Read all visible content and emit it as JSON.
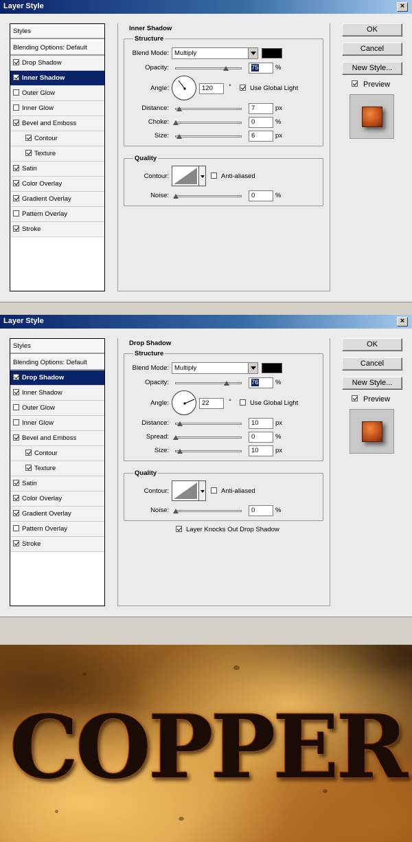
{
  "dialogs": [
    {
      "title": "Layer Style",
      "styles_header": "Styles",
      "blending_options": "Blending Options: Default",
      "items": [
        {
          "label": "Drop Shadow",
          "checked": true
        },
        {
          "label": "Inner Shadow",
          "checked": true,
          "selected": true
        },
        {
          "label": "Outer Glow",
          "checked": false
        },
        {
          "label": "Inner Glow",
          "checked": false
        },
        {
          "label": "Bevel and Emboss",
          "checked": true
        },
        {
          "label": "Contour",
          "checked": true,
          "indent": true
        },
        {
          "label": "Texture",
          "checked": true,
          "indent": true
        },
        {
          "label": "Satin",
          "checked": true
        },
        {
          "label": "Color Overlay",
          "checked": true
        },
        {
          "label": "Gradient Overlay",
          "checked": true
        },
        {
          "label": "Pattern Overlay",
          "checked": false
        },
        {
          "label": "Stroke",
          "checked": true
        }
      ],
      "section_title": "Inner Shadow",
      "structure": {
        "label": "Structure",
        "blend_mode_label": "Blend Mode:",
        "blend_mode": "Multiply",
        "shadow_color": "#000000",
        "opacity_label": "Opacity:",
        "opacity": "75",
        "angle_label": "Angle:",
        "angle": "120",
        "angle_unit": "°",
        "use_global_light": "Use Global Light",
        "use_global_light_checked": true,
        "row3_label": "Distance:",
        "row3": "7",
        "row3_unit": "px",
        "row4_label": "Choke:",
        "row4": "0",
        "row4_unit": "%",
        "row5_label": "Size:",
        "row5": "6",
        "row5_unit": "px",
        "percent": "%"
      },
      "quality": {
        "label": "Quality",
        "contour_label": "Contour:",
        "anti_aliased": "Anti-aliased",
        "anti_aliased_checked": false,
        "noise_label": "Noise:",
        "noise": "0",
        "noise_unit": "%"
      },
      "buttons": {
        "ok": "OK",
        "cancel": "Cancel",
        "new_style": "New Style..."
      },
      "preview": "Preview",
      "preview_checked": true
    },
    {
      "title": "Layer Style",
      "styles_header": "Styles",
      "blending_options": "Blending Options: Default",
      "items": [
        {
          "label": "Drop Shadow",
          "checked": true,
          "selected": true
        },
        {
          "label": "Inner Shadow",
          "checked": true
        },
        {
          "label": "Outer Glow",
          "checked": false
        },
        {
          "label": "Inner Glow",
          "checked": false
        },
        {
          "label": "Bevel and Emboss",
          "checked": true
        },
        {
          "label": "Contour",
          "checked": true,
          "indent": true
        },
        {
          "label": "Texture",
          "checked": true,
          "indent": true
        },
        {
          "label": "Satin",
          "checked": true
        },
        {
          "label": "Color Overlay",
          "checked": true
        },
        {
          "label": "Gradient Overlay",
          "checked": true
        },
        {
          "label": "Pattern Overlay",
          "checked": false
        },
        {
          "label": "Stroke",
          "checked": true
        }
      ],
      "section_title": "Drop Shadow",
      "structure": {
        "label": "Structure",
        "blend_mode_label": "Blend Mode:",
        "blend_mode": "Multiply",
        "shadow_color": "#000000",
        "opacity_label": "Opacity:",
        "opacity": "76",
        "angle_label": "Angle:",
        "angle": "22",
        "angle_unit": "°",
        "use_global_light": "Use Global Light",
        "use_global_light_checked": false,
        "row3_label": "Distance:",
        "row3": "10",
        "row3_unit": "px",
        "row4_label": "Spread:",
        "row4": "0",
        "row4_unit": "%",
        "row5_label": "Size:",
        "row5": "10",
        "row5_unit": "px",
        "percent": "%"
      },
      "quality": {
        "label": "Quality",
        "contour_label": "Contour:",
        "anti_aliased": "Anti-aliased",
        "anti_aliased_checked": false,
        "noise_label": "Noise:",
        "noise": "0",
        "noise_unit": "%"
      },
      "layer_knocks_out": "Layer Knocks Out Drop Shadow",
      "layer_knocks_out_checked": true,
      "buttons": {
        "ok": "OK",
        "cancel": "Cancel",
        "new_style": "New Style..."
      },
      "preview": "Preview",
      "preview_checked": true
    }
  ],
  "artwork": {
    "text": "COPPER"
  }
}
